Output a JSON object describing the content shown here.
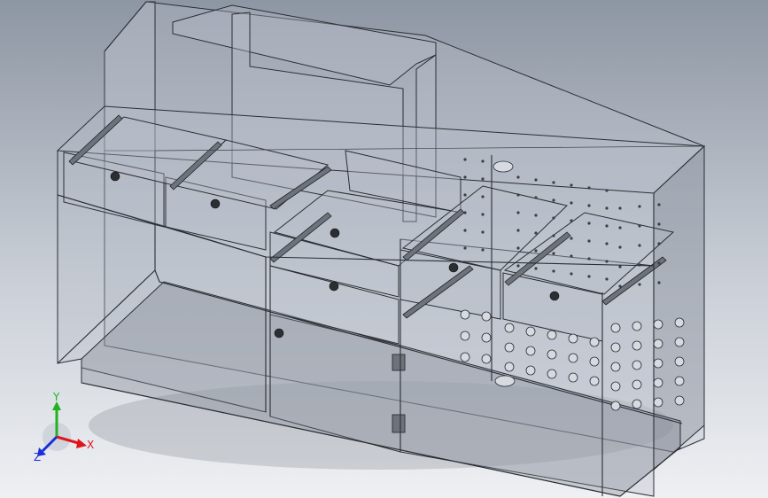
{
  "triad": {
    "x_label": "X",
    "y_label": "Y",
    "z_label": "Z",
    "x_color": "#e0141b",
    "y_color": "#1fb31f",
    "z_color": "#1a2fd6"
  },
  "model": {
    "name_icon": "cabinet-wireframe-icon",
    "background_top": "#8d96a3",
    "background_bottom": "#eef0f3"
  }
}
